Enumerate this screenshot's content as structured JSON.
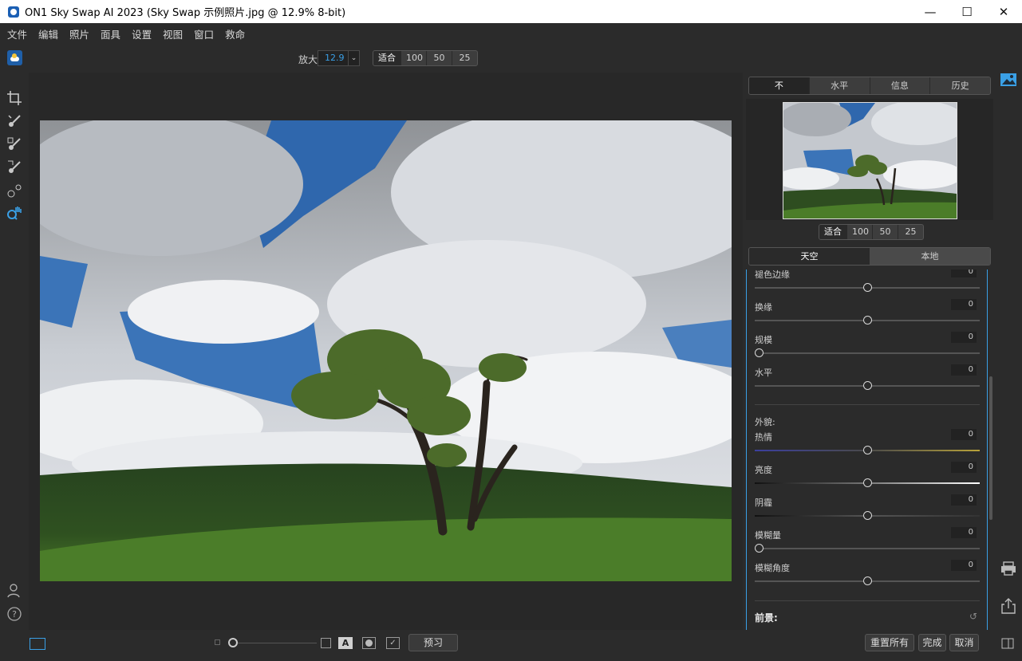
{
  "window": {
    "title": "ON1 Sky Swap AI 2023 (Sky Swap 示例照片.jpg @ 12.9% 8-bit)",
    "minimize": "—",
    "maximize": "☐",
    "close": "✕"
  },
  "menu": [
    "文件",
    "编辑",
    "照片",
    "面具",
    "设置",
    "视图",
    "窗口",
    "救命"
  ],
  "zoom": {
    "label": "放大",
    "value": "12.9",
    "presets": [
      "适合",
      "100",
      "50",
      "25"
    ]
  },
  "panel": {
    "tabs": [
      "不",
      "水平",
      "信息",
      "历史"
    ],
    "active_tab": "不",
    "nav_presets": [
      "适合",
      "100",
      "50",
      "25"
    ],
    "sky_tabs": [
      "天空",
      "本地"
    ],
    "active_sky_tab": "天空",
    "sliders_top": [
      {
        "label": "褪色边缘",
        "value": "0",
        "level": 0.5
      },
      {
        "label": "换缘",
        "value": "0",
        "level": 0.5
      },
      {
        "label": "规模",
        "value": "0",
        "level": 0.0
      },
      {
        "label": "水平",
        "value": "0",
        "level": 0.5
      }
    ],
    "appearance_label": "外貌:",
    "sliders_bottom": [
      {
        "label": "热情",
        "value": "0",
        "level": 0.5
      },
      {
        "label": "亮度",
        "value": "0",
        "level": 0.5
      },
      {
        "label": "阴霾",
        "value": "0",
        "level": 0.5
      },
      {
        "label": "模糊量",
        "value": "0",
        "level": 0.0
      },
      {
        "label": "模糊角度",
        "value": "0",
        "level": 0.5
      }
    ],
    "foreground_label": "前景:"
  },
  "bottom": {
    "preview_button": "预习",
    "reset_all_button": "重置所有",
    "done_button": "完成",
    "cancel_button": "取消",
    "a_label": "A"
  },
  "colors": {
    "accent": "#3aa0e6",
    "background": "#2b2b2b"
  }
}
